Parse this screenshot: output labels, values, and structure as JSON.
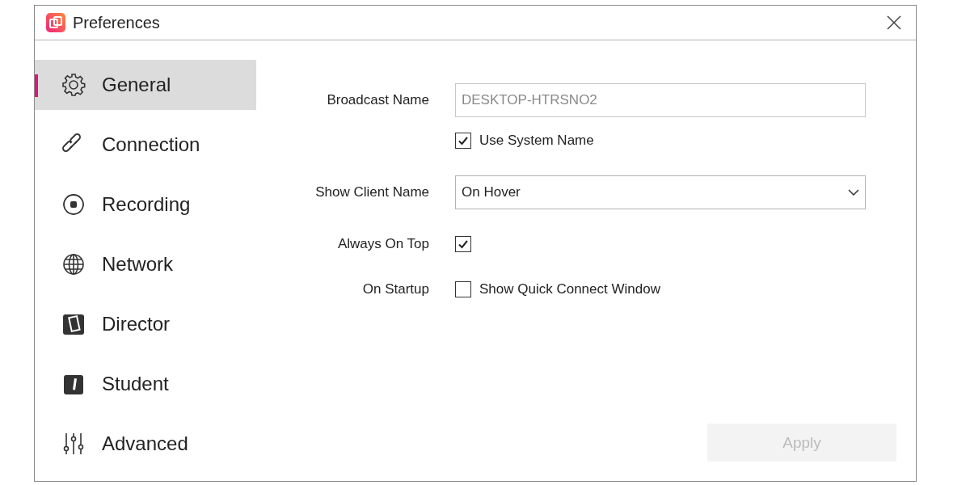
{
  "window": {
    "title": "Preferences"
  },
  "sidebar": {
    "items": [
      {
        "label": "General",
        "selected": true
      },
      {
        "label": "Connection",
        "selected": false
      },
      {
        "label": "Recording",
        "selected": false
      },
      {
        "label": "Network",
        "selected": false
      },
      {
        "label": "Director",
        "selected": false
      },
      {
        "label": "Student",
        "selected": false
      },
      {
        "label": "Advanced",
        "selected": false
      }
    ]
  },
  "form": {
    "fields": [
      {
        "kind": "text",
        "label": "Broadcast Name",
        "value": "DESKTOP-HTRSNO2",
        "disabled": true
      },
      {
        "kind": "checkbox",
        "text": "Use System Name",
        "checked": true
      },
      {
        "kind": "dropdown",
        "label": "Show Client Name",
        "value": "On Hover"
      },
      {
        "kind": "checkbox",
        "label": "Always On Top",
        "checked": true
      },
      {
        "kind": "checkbox",
        "label": "On Startup",
        "text": "Show Quick Connect Window",
        "checked": false
      }
    ]
  },
  "apply_button": {
    "label": "Apply",
    "disabled": true
  }
}
